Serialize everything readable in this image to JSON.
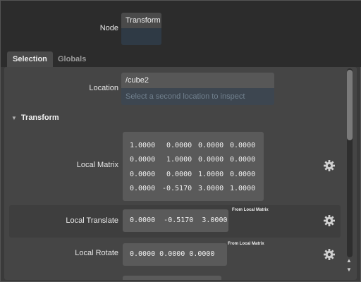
{
  "node": {
    "label": "Node",
    "value": "Transform"
  },
  "tabs": [
    {
      "label": "Selection"
    },
    {
      "label": "Globals"
    }
  ],
  "location": {
    "label": "Location",
    "value": "/cube2",
    "placeholder": "Select a second location to inspect differences"
  },
  "section": {
    "title": "Transform"
  },
  "local_matrix": {
    "label": "Local Matrix",
    "rows": [
      [
        "1.0000",
        "0.0000",
        "0.0000",
        "0.0000"
      ],
      [
        "0.0000",
        "1.0000",
        "0.0000",
        "0.0000"
      ],
      [
        "0.0000",
        "0.0000",
        "1.0000",
        "0.0000"
      ],
      [
        "0.0000",
        "-0.5170",
        "3.0000",
        "1.0000"
      ]
    ]
  },
  "local_translate": {
    "label": "Local Translate",
    "values": [
      "0.0000",
      "-0.5170",
      "3.0000"
    ],
    "source": "From Local Matrix"
  },
  "local_rotate": {
    "label": "Local Rotate",
    "values": [
      "0.0000",
      "0.0000",
      "0.0000"
    ],
    "source": "From Local Matrix"
  },
  "icons": {
    "gear": "gear-icon",
    "collapse": "triangle-down-icon",
    "scroll_up": "arrow-up-icon",
    "scroll_down": "arrow-down-icon"
  }
}
